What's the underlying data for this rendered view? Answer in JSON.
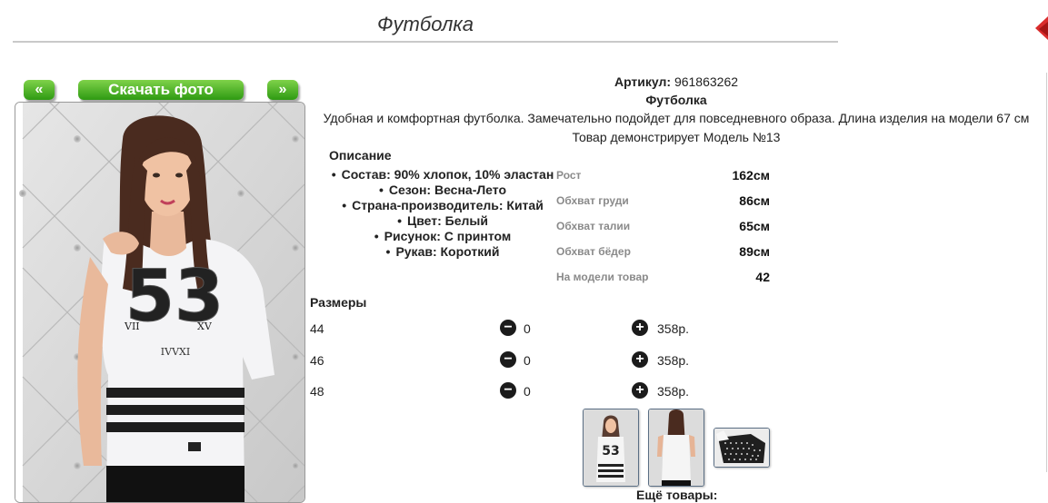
{
  "page": {
    "title": "Футболка"
  },
  "gallery": {
    "prev_label": "«",
    "download_label": "Скачать фото",
    "next_label": "»"
  },
  "product": {
    "article_label": "Артикул:",
    "article_value": "961863262",
    "name": "Футболка",
    "description_text": "Удобная и комфортная футболка. Замечательно подойдет для повседневного образа. Длина изделия на модели 67 см",
    "model_text": "Товар демонстрирует Модель №13",
    "print_digits": "53"
  },
  "description": {
    "heading": "Описание",
    "items": [
      "Состав: 90% хлопок, 10% эластан",
      "Сезон: Весна-Лето",
      "Страна-производитель: Китай",
      "Цвет: Белый",
      "Рисунок: С принтом",
      "Рукав: Короткий"
    ]
  },
  "measurements": [
    {
      "label": "Рост",
      "value": "162см"
    },
    {
      "label": "Обхват груди",
      "value": "86см"
    },
    {
      "label": "Обхват талии",
      "value": "65см"
    },
    {
      "label": "Обхват бёдер",
      "value": "89см"
    },
    {
      "label": "На модели товар",
      "value": "42"
    }
  ],
  "sizes": {
    "heading": "Размеры",
    "rows": [
      {
        "size": "44",
        "qty": "0",
        "price": "358р."
      },
      {
        "size": "46",
        "qty": "0",
        "price": "358р."
      },
      {
        "size": "48",
        "qty": "0",
        "price": "358р."
      }
    ]
  },
  "more_goods_label": "Ещё товары:",
  "colors": {
    "accent_green_top": "#7fd24a",
    "accent_green_bottom": "#2e9a12",
    "corner_red": "#d92c2c"
  }
}
